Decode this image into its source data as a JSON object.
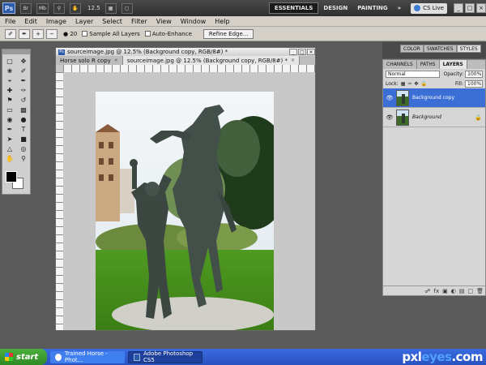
{
  "appbar": {
    "logo": "Ps",
    "zoom": "12.5",
    "workspaces": [
      "ESSENTIALS",
      "DESIGN",
      "PAINTING"
    ],
    "more": "»",
    "cslive": "CS Live"
  },
  "menu": [
    "File",
    "Edit",
    "Image",
    "Layer",
    "Select",
    "Filter",
    "View",
    "Window",
    "Help"
  ],
  "options": {
    "brush_size": "20",
    "sample_all_layers": "Sample All Layers",
    "auto_enhance": "Auto-Enhance",
    "refine_edge": "Refine Edge..."
  },
  "document": {
    "window_title": "sourceimage.jpg @ 12.5% (Background copy, RGB/8#) *",
    "tabs": [
      {
        "label": "Horse solo R copy"
      },
      {
        "label": "sourceimage.jpg @ 12.5% (Background copy, RGB/8#) *"
      }
    ]
  },
  "panels": {
    "top_tabs": [
      "COLOR",
      "SWATCHES",
      "STYLES"
    ],
    "layer_tabs": [
      "CHANNELS",
      "PATHS",
      "LAYERS"
    ],
    "blend_mode": "Normal",
    "opacity_label": "Opacity:",
    "opacity_value": "100%",
    "lock_label": "Lock:",
    "fill_label": "Fill:",
    "fill_value": "100%",
    "layers": [
      {
        "name": "Background copy"
      },
      {
        "name": "Background"
      }
    ]
  },
  "taskbar": {
    "start": "start",
    "tasks": [
      {
        "label": "Trained Horse - Phot..."
      },
      {
        "label": "Adobe Photoshop CS5"
      }
    ],
    "watermark_a": "pxl",
    "watermark_b": "eyes",
    "watermark_c": ".com"
  },
  "colors": {
    "selected_layer": "#3b6fd6",
    "taskbar": "#2a52c0"
  }
}
